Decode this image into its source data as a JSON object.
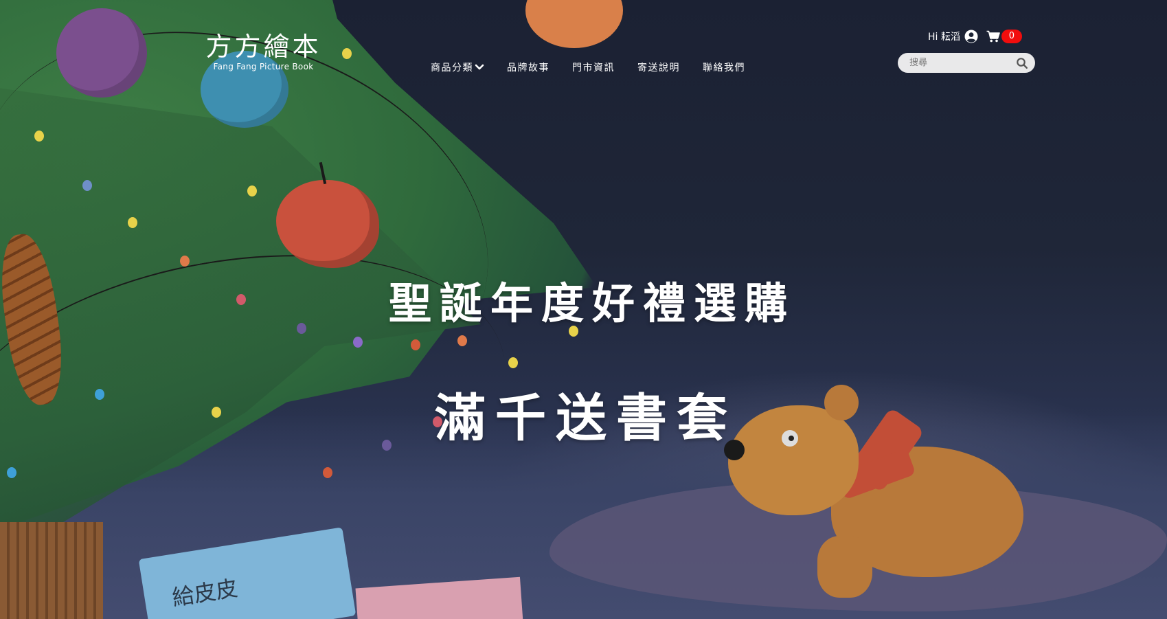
{
  "logo": {
    "title": "方方繪本",
    "subtitle": "Fang Fang Picture Book"
  },
  "nav": {
    "items": [
      {
        "label": "商品分類",
        "icon": "chevron-down-icon"
      },
      {
        "label": "品牌故事"
      },
      {
        "label": "門市資訊"
      },
      {
        "label": "寄送說明"
      },
      {
        "label": "聯絡我們"
      }
    ]
  },
  "user": {
    "greeting": "Hi 耘滔",
    "icon": "user-circle-icon"
  },
  "cart": {
    "icon": "cart-icon",
    "count": "0"
  },
  "search": {
    "placeholder": "搜尋",
    "icon": "search-icon"
  },
  "hero": {
    "headline": "聖誕年度好禮選購",
    "subheadline": "滿千送書套",
    "illustration_tag_text": "給皮皮"
  },
  "colors": {
    "badge": "#f20d0d",
    "search_bg": "#e9e9ea",
    "text": "#ffffff",
    "background": "#1d2435"
  }
}
